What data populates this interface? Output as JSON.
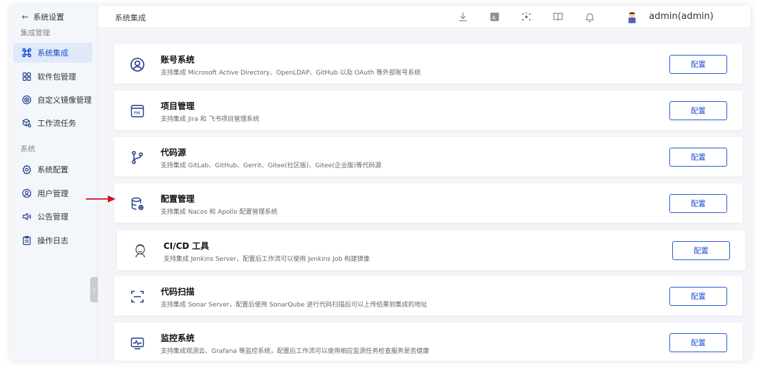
{
  "sidebar": {
    "back_label": "系统设置",
    "group_integration": "集成管理",
    "group_system": "系统",
    "items": [
      {
        "label": "系统集成",
        "icon": "command-icon",
        "active": true
      },
      {
        "label": "软件包管理",
        "icon": "grid-icon",
        "active": false
      },
      {
        "label": "自定义镜像管理",
        "icon": "image-disc-icon",
        "active": false
      },
      {
        "label": "工作流任务",
        "icon": "cube-gear-icon",
        "active": false
      },
      {
        "label": "系统配置",
        "icon": "settings-icon",
        "active": false
      },
      {
        "label": "用户管理",
        "icon": "user-circle-icon",
        "active": false
      },
      {
        "label": "公告管理",
        "icon": "speaker-icon",
        "active": false
      },
      {
        "label": "操作日志",
        "icon": "clipboard-icon",
        "active": false
      }
    ]
  },
  "header": {
    "breadcrumb": "系统集成",
    "user": "admin(admin)"
  },
  "cards": [
    {
      "title": "账号系统",
      "desc": "支持集成 Microsoft Active Directory、OpenLDAP、GitHub 以及 OAuth 等外部账号系统",
      "button": "配置",
      "icon": "account-icon"
    },
    {
      "title": "项目管理",
      "desc": "支持集成 Jira 和 飞书项目管理系统",
      "button": "配置",
      "icon": "pm-icon"
    },
    {
      "title": "代码源",
      "desc": "支持集成 GitLab、GitHub、Gerrit、Gitee(社区版)、Gitee(企业版)等代码源",
      "button": "配置",
      "icon": "git-branch-icon"
    },
    {
      "title": "配置管理",
      "desc": "支持集成 Nacos 和 Apollo 配置管理系统",
      "button": "配置",
      "icon": "database-gear-icon"
    },
    {
      "title": "CI/CD 工具",
      "desc": "支持集成 Jenkins Server，配置后工作流可以使用 Jenkins Job 构建镜像",
      "button": "配置",
      "icon": "jenkins-icon"
    },
    {
      "title": "代码扫描",
      "desc": "支持集成 Sonar Server，配置后使用 SonarQube 进行代码扫描后可以上传结果到集成的地址",
      "button": "配置",
      "icon": "scan-icon"
    },
    {
      "title": "监控系统",
      "desc": "支持集成观测云、Grafana 等监控系统，配置后工作流可以使用相应监测任务检查服务是否健康",
      "button": "配置",
      "icon": "monitor-icon"
    }
  ],
  "colors": {
    "accent": "#1c4fd1",
    "active_bg": "#dfe9f9",
    "annotation_arrow": "#d0141b"
  }
}
